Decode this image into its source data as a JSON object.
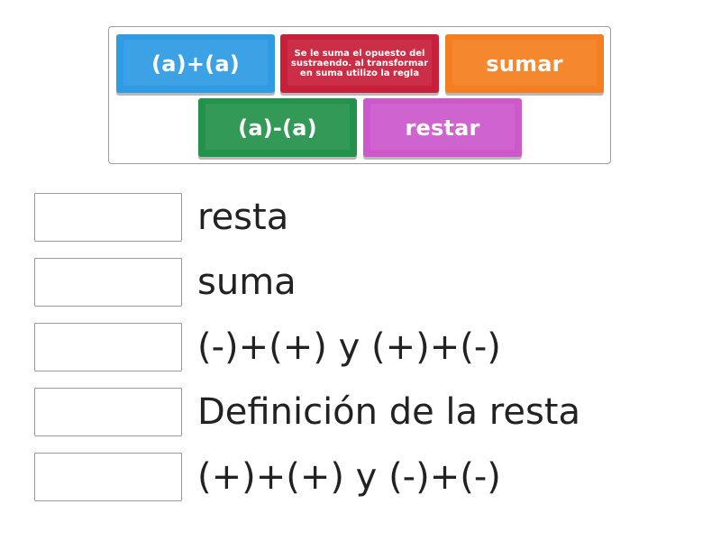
{
  "tiles": [
    {
      "label": "(a)+(a)",
      "color": "#2f9be3"
    },
    {
      "label": "Se le suma el opuesto del sustraendo. al transformar en suma utilizo la regla",
      "color": "#c8203a"
    },
    {
      "label": "sumar",
      "color": "#f57e20"
    },
    {
      "label": "(a)-(a)",
      "color": "#23924a"
    },
    {
      "label": "restar",
      "color": "#cc58cc"
    }
  ],
  "rows": [
    {
      "label": "resta"
    },
    {
      "label": "suma"
    },
    {
      "label": "(-)+(+) y (+)+(-)"
    },
    {
      "label": "Definición de la resta"
    },
    {
      "label": "(+)+(+) y (-)+(-)"
    }
  ]
}
